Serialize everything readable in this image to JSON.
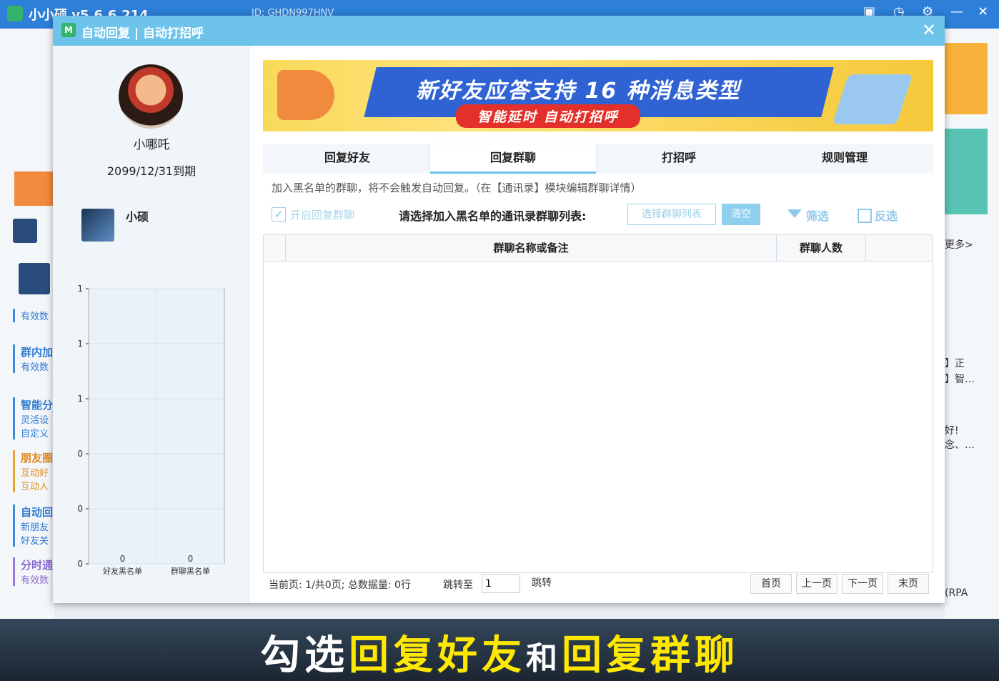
{
  "app": {
    "title": "小小硕 v5.6.6.214",
    "id_text": "ID: GHDN997HNV",
    "min": "—",
    "close": "✕"
  },
  "bg_left_items": [
    {
      "title": "有效数"
    },
    {
      "title": "群内加",
      "sub": "有效数"
    },
    {
      "title": "智能分",
      "sub": "灵活设",
      "sub2": "自定义"
    },
    {
      "title": "朋友圈",
      "sub": "互动好",
      "sub2": "互动人"
    },
    {
      "title": "自动回",
      "sub": "新朋友",
      "sub2": "好友关"
    },
    {
      "title": "分时通",
      "sub": "有效数"
    }
  ],
  "bg_right": {
    "more": "更多>",
    "t1": "】正",
    "t2": "】智…",
    "t3": "好!",
    "t4": "念、…",
    "t5": "(RPA"
  },
  "dialog": {
    "title": "自动回复 | 自动打招呼",
    "close": "✕"
  },
  "profile": {
    "name": "小哪吒",
    "expiry": "2099/12/31到期"
  },
  "account": {
    "name": "小硕"
  },
  "chart_data": {
    "type": "bar",
    "categories": [
      "好友黑名单",
      "群聊黑名单"
    ],
    "values": [
      0,
      0
    ],
    "y_ticks": [
      "1",
      "1",
      "1",
      "0",
      "0",
      "0"
    ],
    "data_labels": [
      "0",
      "0"
    ]
  },
  "banner": {
    "title": "新好友应答支持 16 种消息类型",
    "subtitle": "智能延时  自动打招呼"
  },
  "tabs": [
    {
      "label": "回复好友",
      "active": false
    },
    {
      "label": "回复群聊",
      "active": true
    },
    {
      "label": "打招呼",
      "active": false
    },
    {
      "label": "规则管理",
      "active": false
    }
  ],
  "notice": "加入黑名单的群聊，将不会触发自动回复。（在【通讯录】模块编辑群聊详情）",
  "toolbar": {
    "checkbox_label": "开启回复群聊",
    "checkbox_checked": true,
    "select_label": "请选择加入黑名单的通讯录群聊列表:",
    "select_button": "选择群聊列表",
    "clear_button": "清空",
    "filter": "筛选",
    "invert": "反选"
  },
  "table": {
    "columns": [
      "",
      "群聊名称或备注",
      "群聊人数",
      ""
    ],
    "rows": []
  },
  "pager": {
    "info": "当前页: 1/共0页; 总数据量: 0行",
    "jump_label": "跳转至",
    "jump_value": "1",
    "jump_button": "跳转",
    "first": "首页",
    "prev": "上一页",
    "next": "下一页",
    "last": "末页"
  },
  "caption": {
    "p1": "勾选",
    "p2": "回复好友",
    "p3": "和",
    "p4": "回复群聊"
  },
  "colors": {
    "title_bar": "#6ec3ea",
    "app_bar": "#2d7fd8",
    "accent": "#8fd0ef",
    "highlight": "#ffe800"
  }
}
